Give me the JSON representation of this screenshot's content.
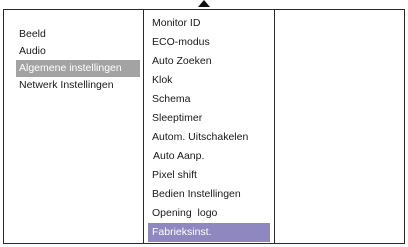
{
  "main_menu": {
    "items": [
      {
        "label": "Beeld"
      },
      {
        "label": "Audio"
      },
      {
        "label": "Algemene instellingen"
      },
      {
        "label": "Netwerk Instellingen"
      }
    ],
    "selected_index": 2,
    "selected_color": "#a3a3a3"
  },
  "sub_menu": {
    "items": [
      {
        "label": "Monitor ID"
      },
      {
        "label": "ECO-modus"
      },
      {
        "label": "Auto Zoeken"
      },
      {
        "label": "Klok"
      },
      {
        "label": "Schema"
      },
      {
        "label": "Sleeptimer"
      },
      {
        "label": "Autom. Uitschakelen"
      },
      {
        "label": "Auto Aanp."
      },
      {
        "label": "Pixel shift"
      },
      {
        "label": "Bedien Instellingen"
      },
      {
        "label": "Opening  logo"
      },
      {
        "label": "Fabrieksinst."
      }
    ],
    "selected_index": 11,
    "selected_color": "#8f88c0"
  },
  "icons": {
    "scroll_up": "up-arrow-icon"
  }
}
